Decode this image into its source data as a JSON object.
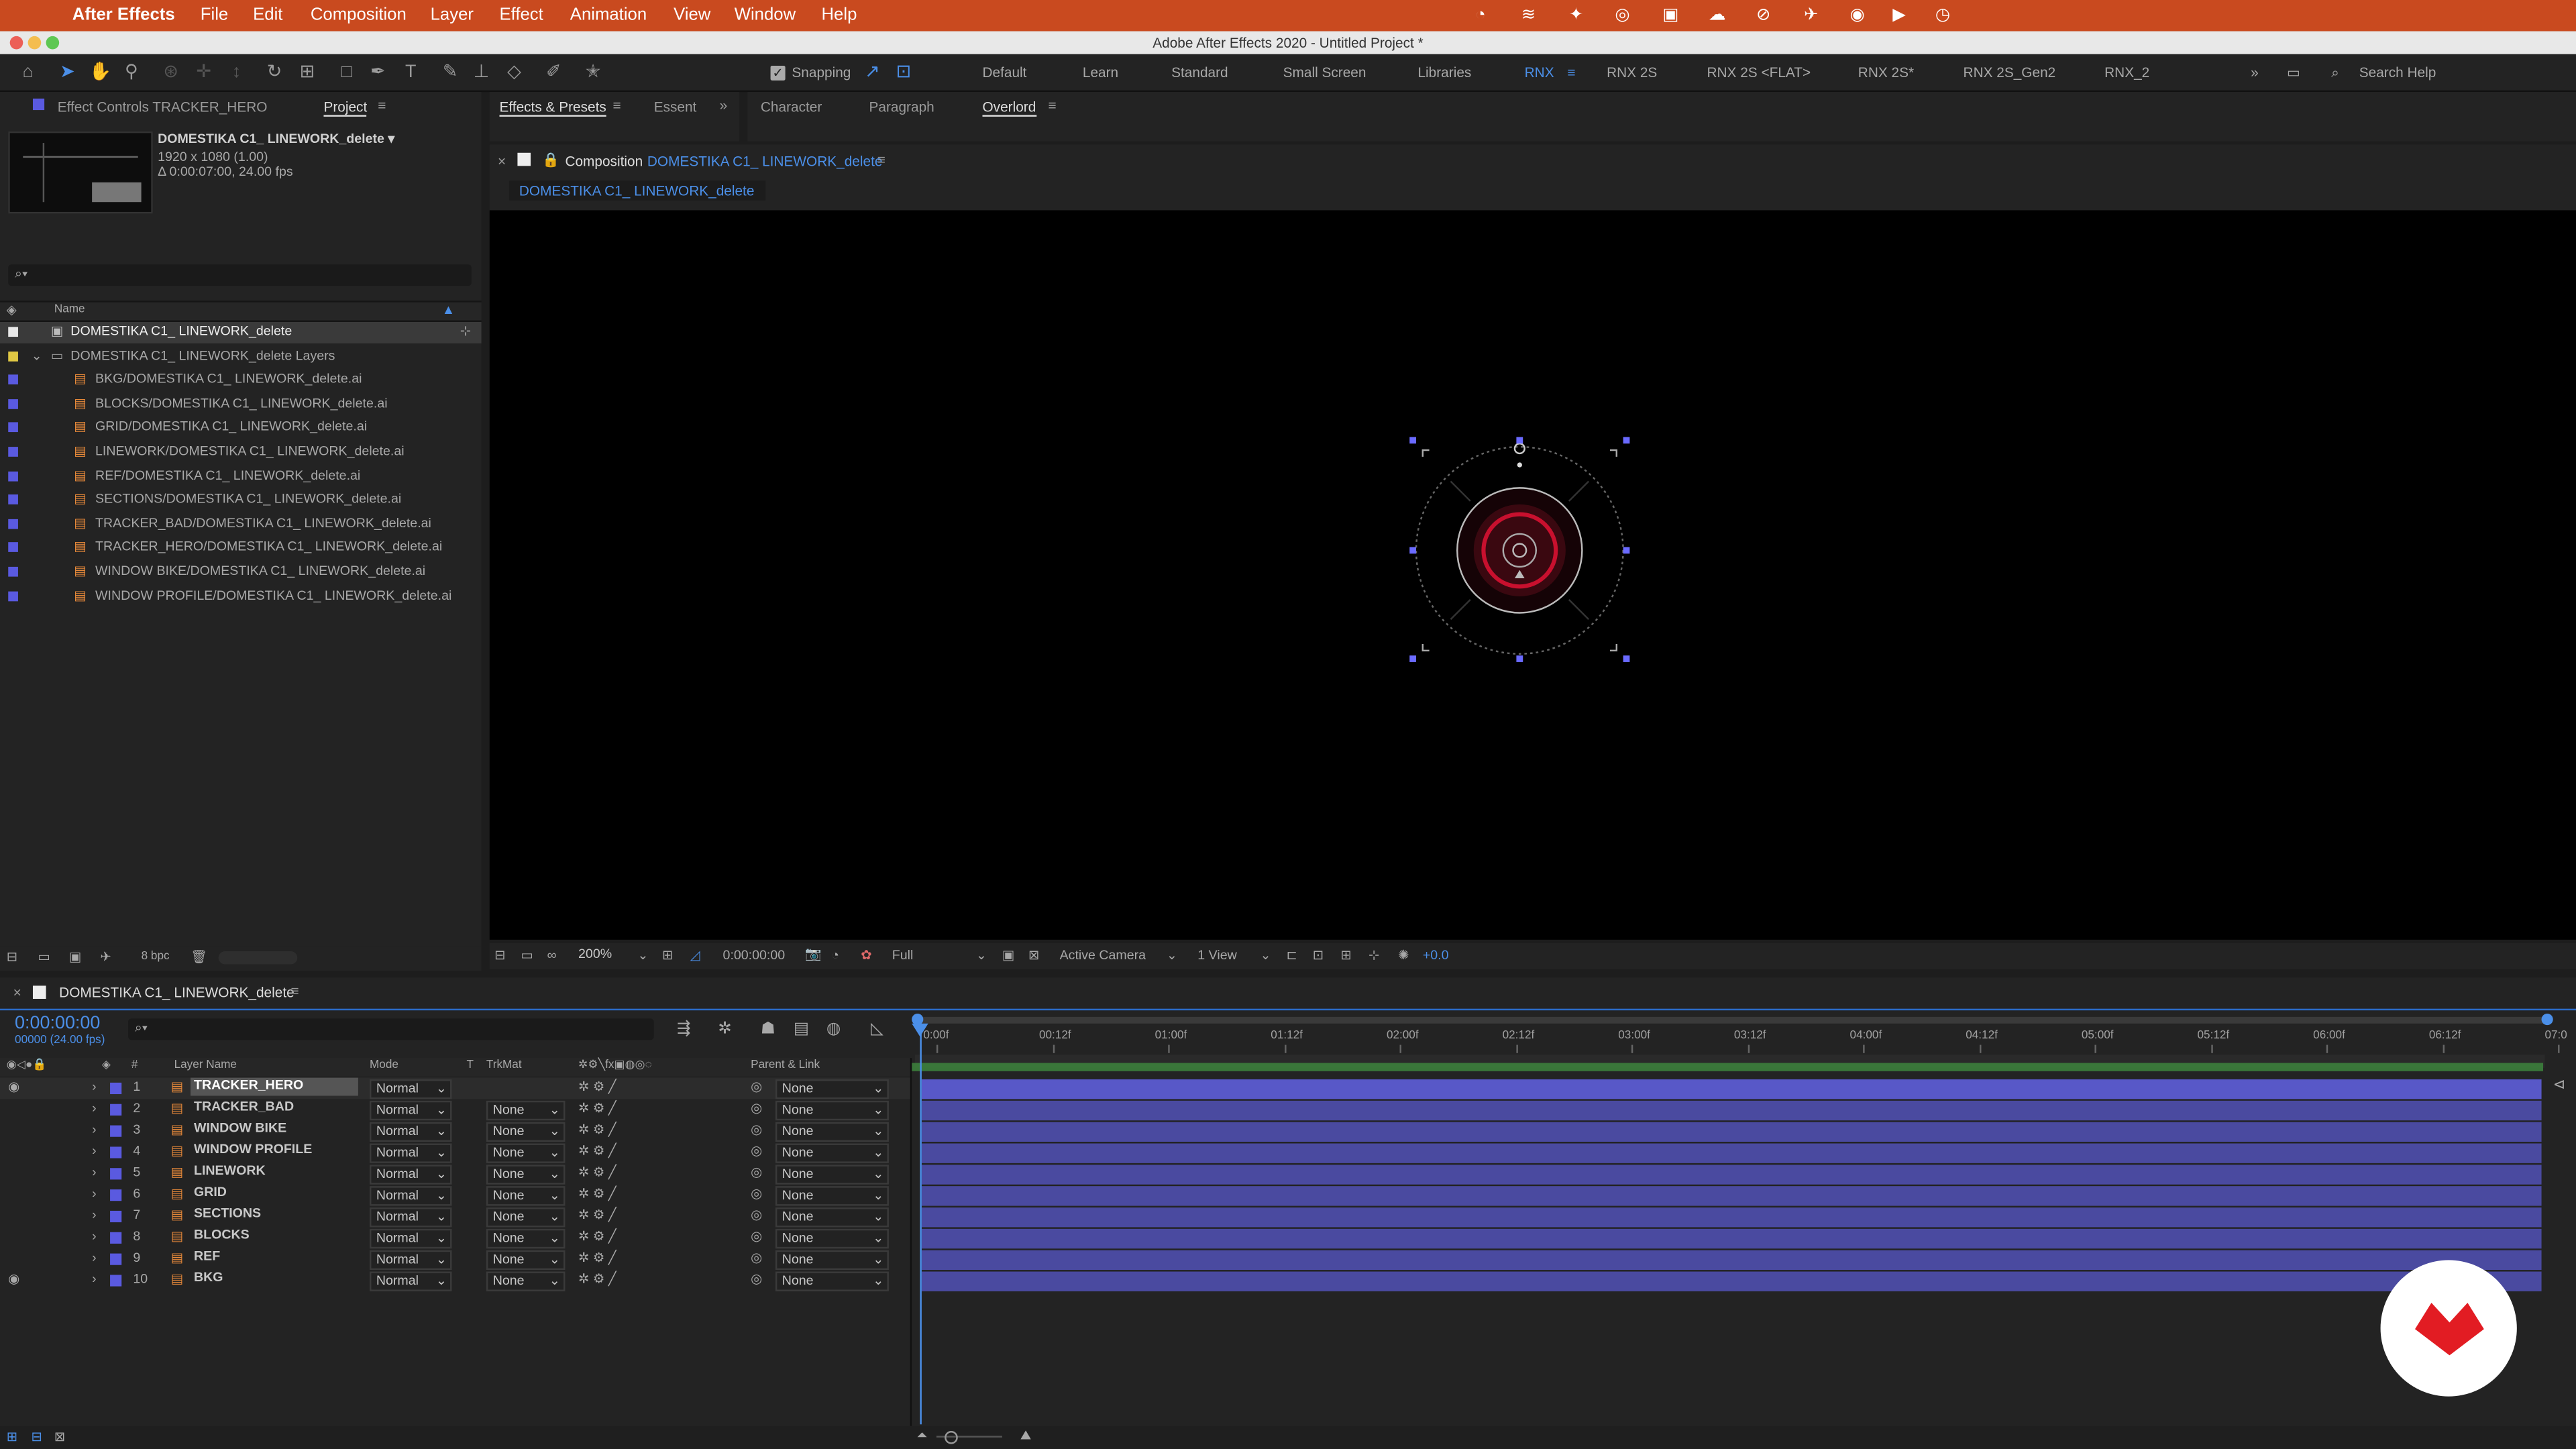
{
  "menubar": {
    "app": "After Effects",
    "items": [
      "File",
      "Edit",
      "Composition",
      "Layer",
      "Effect",
      "Animation",
      "View",
      "Window",
      "Help"
    ]
  },
  "titlebar": {
    "title": "Adobe After Effects 2020 - Untitled Project *"
  },
  "toolbar": {
    "snapping_label": "Snapping",
    "workspaces": [
      "Default",
      "Learn",
      "Standard",
      "Small Screen",
      "Libraries",
      "RNX",
      "RNX 2S",
      "RNX 2S <FLAT>",
      "RNX 2S*",
      "RNX 2S_Gen2",
      "RNX_2"
    ],
    "active_workspace": "RNX",
    "search_placeholder": "Search Help"
  },
  "project_panel": {
    "tab_effect_controls": "Effect Controls TRACKER_HERO",
    "tab_project": "Project",
    "comp_name": "DOMESTIKA C1_ LINEWORK_delete ▾",
    "comp_size": "1920 x 1080 (1.00)",
    "comp_duration": "Δ 0:00:07:00, 24.00 fps",
    "search_placeholder": "⌕▾",
    "col_name": "Name",
    "items": [
      {
        "name": "DOMESTIKA C1_ LINEWORK_delete",
        "type": "comp",
        "selected": true,
        "color": "#e8e8e8"
      },
      {
        "name": "DOMESTIKA C1_ LINEWORK_delete Layers",
        "type": "folder",
        "color": "#e0c844"
      },
      {
        "name": "BKG/DOMESTIKA C1_ LINEWORK_delete.ai",
        "type": "ai",
        "color": "#5a5ae0"
      },
      {
        "name": "BLOCKS/DOMESTIKA C1_ LINEWORK_delete.ai",
        "type": "ai",
        "color": "#5a5ae0"
      },
      {
        "name": "GRID/DOMESTIKA C1_ LINEWORK_delete.ai",
        "type": "ai",
        "color": "#5a5ae0"
      },
      {
        "name": "LINEWORK/DOMESTIKA C1_ LINEWORK_delete.ai",
        "type": "ai",
        "color": "#5a5ae0"
      },
      {
        "name": "REF/DOMESTIKA C1_ LINEWORK_delete.ai",
        "type": "ai",
        "color": "#5a5ae0"
      },
      {
        "name": "SECTIONS/DOMESTIKA C1_ LINEWORK_delete.ai",
        "type": "ai",
        "color": "#5a5ae0"
      },
      {
        "name": "TRACKER_BAD/DOMESTIKA C1_ LINEWORK_delete.ai",
        "type": "ai",
        "color": "#5a5ae0"
      },
      {
        "name": "TRACKER_HERO/DOMESTIKA C1_ LINEWORK_delete.ai",
        "type": "ai",
        "color": "#5a5ae0"
      },
      {
        "name": "WINDOW BIKE/DOMESTIKA C1_ LINEWORK_delete.ai",
        "type": "ai",
        "color": "#5a5ae0"
      },
      {
        "name": "WINDOW PROFILE/DOMESTIKA C1_ LINEWORK_delete.ai",
        "type": "ai",
        "color": "#5a5ae0"
      }
    ],
    "bpc": "8 bpc"
  },
  "effects_panel": {
    "tab1": "Effects & Presets",
    "tab2": "Essent",
    "tab3": "Character",
    "tab4": "Paragraph",
    "tab5": "Overlord"
  },
  "composition": {
    "header_label": "Composition",
    "comp_name": "DOMESTIKA C1_ LINEWORK_delete",
    "breadcrumb": "DOMESTIKA C1_ LINEWORK_delete",
    "zoom": "200%",
    "timecode": "0:00:00:00",
    "resolution": "Full",
    "camera": "Active Camera",
    "view": "1 View",
    "exposure": "+0.0"
  },
  "timeline": {
    "tab_label": "DOMESTIKA C1_ LINEWORK_delete",
    "current_time": "0:00:00:00",
    "frame_info": "00000 (24.00 fps)",
    "search_placeholder": "⌕▾",
    "col_hash": "#",
    "col_layer_name": "Layer Name",
    "col_mode": "Mode",
    "col_t": "T",
    "col_trkmat": "TrkMat",
    "col_parent": "Parent & Link",
    "ruler": [
      "0:00f",
      "00:12f",
      "01:00f",
      "01:12f",
      "02:00f",
      "02:12f",
      "03:00f",
      "03:12f",
      "04:00f",
      "04:12f",
      "05:00f",
      "05:12f",
      "06:00f",
      "06:12f",
      "07:0"
    ],
    "layers": [
      {
        "num": "1",
        "name": "TRACKER_HERO",
        "mode": "Normal",
        "trkmat": "",
        "parent": "None",
        "visible": true,
        "selected": true
      },
      {
        "num": "2",
        "name": "TRACKER_BAD",
        "mode": "Normal",
        "trkmat": "None",
        "parent": "None",
        "visible": false
      },
      {
        "num": "3",
        "name": "WINDOW BIKE",
        "mode": "Normal",
        "trkmat": "None",
        "parent": "None",
        "visible": false
      },
      {
        "num": "4",
        "name": "WINDOW PROFILE",
        "mode": "Normal",
        "trkmat": "None",
        "parent": "None",
        "visible": false
      },
      {
        "num": "5",
        "name": "LINEWORK",
        "mode": "Normal",
        "trkmat": "None",
        "parent": "None",
        "visible": false
      },
      {
        "num": "6",
        "name": "GRID",
        "mode": "Normal",
        "trkmat": "None",
        "parent": "None",
        "visible": false
      },
      {
        "num": "7",
        "name": "SECTIONS",
        "mode": "Normal",
        "trkmat": "None",
        "parent": "None",
        "visible": false
      },
      {
        "num": "8",
        "name": "BLOCKS",
        "mode": "Normal",
        "trkmat": "None",
        "parent": "None",
        "visible": false
      },
      {
        "num": "9",
        "name": "REF",
        "mode": "Normal",
        "trkmat": "None",
        "parent": "None",
        "visible": false
      },
      {
        "num": "10",
        "name": "BKG",
        "mode": "Normal",
        "trkmat": "None",
        "parent": "None",
        "visible": true
      }
    ]
  },
  "colors": {
    "accent": "#4b8fe8",
    "menubar": "#c94a1f",
    "layer_label": "#5a5ae0",
    "layer_bar": "#4a4aa0",
    "tracker_red": "#c8102e",
    "domestika_red": "#e21c23"
  }
}
